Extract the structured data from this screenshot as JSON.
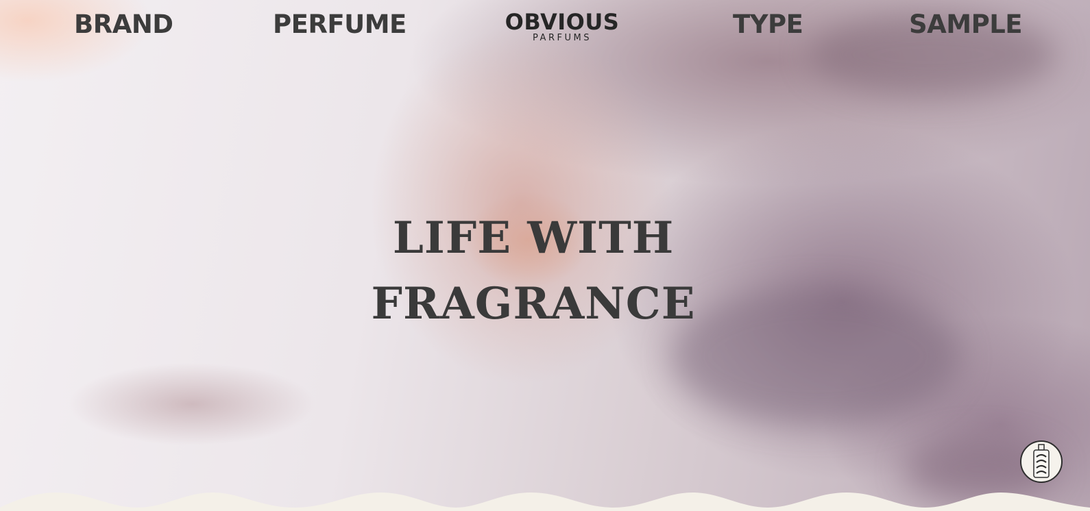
{
  "nav": {
    "brand": "BRAND",
    "perfume": "PERFUME",
    "type": "TYPE",
    "sample": "SAMPLE"
  },
  "logo": {
    "main": "OBVIOUS",
    "sub": "PARFUMS"
  },
  "hero": {
    "line1": "LIFE WITH",
    "line2": "FRAGRANCE"
  },
  "floating_button": {
    "icon": "perfume-bottle-icon"
  },
  "colors": {
    "text": "#3c3c3c",
    "wave": "#f4f0e8",
    "button_border": "#2e2e2e"
  }
}
